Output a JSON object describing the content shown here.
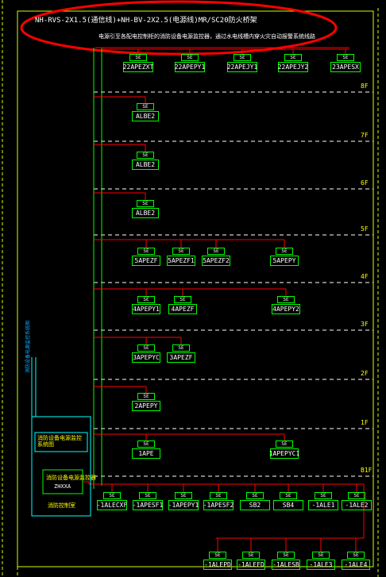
{
  "header": {
    "cable_spec": "NH-RVS-2X1.5(通信线)+NH-BV-2X2.5(电源线)MR/SC20防火桥架",
    "note": "电源引至各配电控制柜的消防设备电源监控器，通过水电线槽内穿火灾自动报警系统线路"
  },
  "floors": [
    "8F",
    "7F",
    "6F",
    "5F",
    "4F",
    "3F",
    "2F",
    "1F",
    "B1F"
  ],
  "panel": {
    "monitor_label": "消防设备电源监控器",
    "monitor_model": "ZHXXA",
    "room_label": "消防控制室",
    "vertical_label": "消防设备电源监控系统图"
  },
  "rows": {
    "top": [
      "22APEZXT",
      "22APEPY1",
      "22APEJY1",
      "22APEJY2",
      "23APESX"
    ],
    "r8": [
      "ALBE2"
    ],
    "r7": [
      "ALBE2"
    ],
    "r6": [
      "ALBE2"
    ],
    "r5": [
      "5APEZF",
      "5APEZF1",
      "5APEZF2",
      "5APEPY"
    ],
    "r4": [
      "4APEPY1",
      "4APEZF",
      "4APEPY2"
    ],
    "r3": [
      "3APEPYC",
      "3APEZF"
    ],
    "r2": [
      "2APEPY"
    ],
    "r1": [
      "1APE",
      "1APEPYC1"
    ],
    "b1": [
      "-1ALECXF",
      "-1APESF1",
      "-1APEPY1",
      "-1APESF2",
      "SB2",
      "SB4",
      "-1ALE1",
      "-1ALE2"
    ],
    "b2": [
      "-1ALEPD",
      "-1ALEFD",
      "-1ALESB",
      "-1ALE3",
      "-1ALE4"
    ]
  },
  "se_label": "SE"
}
